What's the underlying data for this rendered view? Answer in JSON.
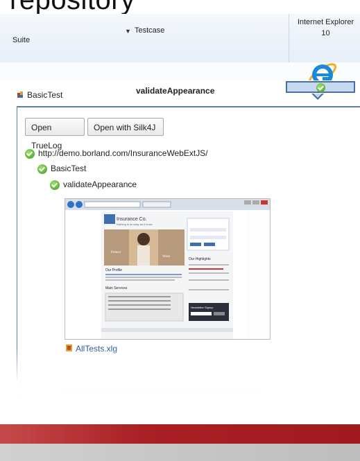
{
  "slide": {
    "title": "repository"
  },
  "grid": {
    "columns": {
      "suite": "Suite",
      "testcase": "Testcase",
      "browser": "Internet Explorer",
      "browser_version": "10"
    },
    "row": {
      "suite": "BasicTest",
      "testcase": "validateAppearance"
    },
    "colors": {
      "result_cell_bg": "#c7d9ef",
      "result_cell_border": "#4b6ea0",
      "pass_green": "#3f9b1e"
    }
  },
  "details": {
    "buttons": {
      "open_truelog": "Open TrueLog",
      "open_silk4j": "Open with Silk4J"
    },
    "tree": {
      "url": "http://demo.borland.com/InsuranceWebExtJS/",
      "suite": "BasicTest",
      "testcase": "validateAppearance"
    },
    "attachment": "AllTests.xlg"
  },
  "screenshot": {
    "site_name": "Insurance Co.",
    "tagline": "Nothing is as easy as it looks",
    "nav": [
      "Login",
      "Pass"
    ],
    "sections": [
      "Our Profile",
      "Our Highlights",
      "Main Services",
      "Newsletter Signup"
    ]
  },
  "icons": {
    "dropdown": "chevron-down-icon",
    "browser": "internet-explorer-icon",
    "status": "check-circle-icon",
    "suite": "suite-icon",
    "file": "file-icon"
  }
}
